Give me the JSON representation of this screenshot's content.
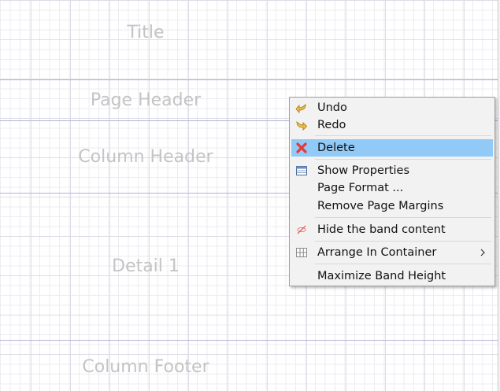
{
  "bands": {
    "title": "Title",
    "page_header": "Page Header",
    "column_header": "Column Header",
    "detail": "Detail 1",
    "column_footer": "Column Footer"
  },
  "context_menu": {
    "undo": "Undo",
    "redo": "Redo",
    "delete": "Delete",
    "show_properties": "Show Properties",
    "page_format": "Page Format ...",
    "remove_page_margins": "Remove Page Margins",
    "hide_band_content": "Hide the band content",
    "arrange_in_container": "Arrange In Container",
    "maximize_band_height": "Maximize Band Height",
    "selected_item": "delete"
  },
  "icons": {
    "undo": "undo-arrow-icon",
    "redo": "redo-arrow-icon",
    "delete": "red-x-delete-icon",
    "show_properties": "properties-table-icon",
    "hide_band_content": "hide-eye-icon",
    "arrange_in_container": "grid-container-icon",
    "submenu": "chevron-right-icon"
  },
  "colors": {
    "selection": "#91c9f7",
    "band_line": "#b3b3d8",
    "band_label": "#c4c4c4",
    "menu_background": "#f2f2f2",
    "delete_icon": "#e8363a",
    "arrow_icon": "#e9b53c"
  }
}
